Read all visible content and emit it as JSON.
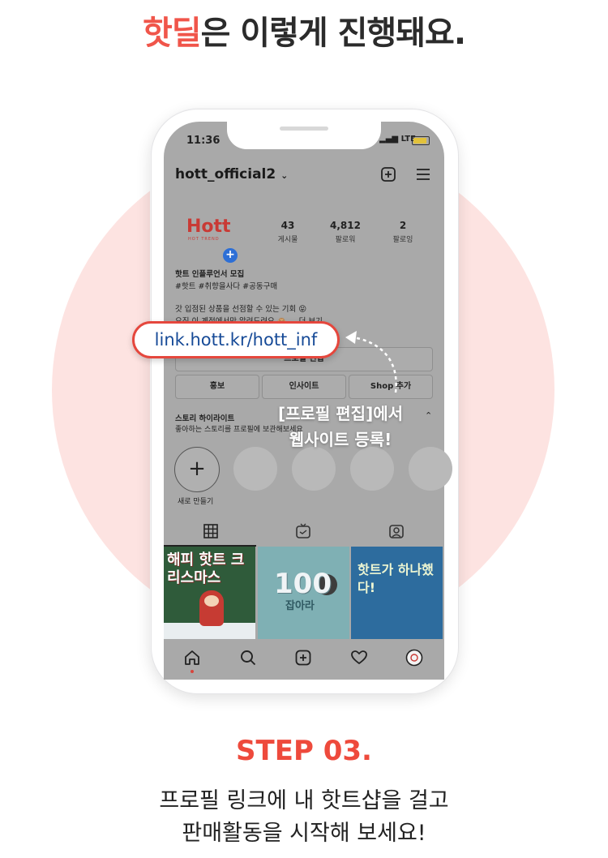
{
  "headline": {
    "highlight": "핫딜",
    "rest": "은 이렇게 진행돼요."
  },
  "status_bar": {
    "time": "11:36",
    "network": "LTE"
  },
  "profile": {
    "username": "hott_official2",
    "logo_text": "Hott",
    "logo_sub": "HOT TREND",
    "stats": [
      {
        "value": "43",
        "label": "게시물"
      },
      {
        "value": "4,812",
        "label": "팔로워"
      },
      {
        "value": "2",
        "label": "팔로잉"
      }
    ],
    "bio": [
      "핫트 인플루언서 모집",
      "#핫트 #취향을사다 #공동구매",
      "갓 입점된 상품을 선점할 수 있는 기회 😝",
      "오직 이 계정에서만 알려드려요 🙈 ... 더 보기"
    ],
    "link": "link.hott.kr/hott_inf",
    "edit_button": "프로필 편집",
    "action_buttons": [
      "홍보",
      "인사이트",
      "Shop 추가"
    ],
    "highlights_title": "스토리 하이라이트",
    "highlights_sub": "좋아하는 스토리를 프로필에 보관해보세요",
    "new_story": "새로 만들기"
  },
  "annotation": {
    "line1": "[프로필 편집]에서",
    "line2": "웹사이트 등록!"
  },
  "posts": [
    {
      "title": "해피 핫트 크리스마스"
    },
    {
      "title": "100",
      "sub": "잡아라"
    },
    {
      "title": "핫트가 하나했다!"
    }
  ],
  "step": {
    "label": "STEP 03.",
    "line1": "프로필 링크에 내 핫트샵을 걸고",
    "line2": "판매활동을 시작해 보세요!"
  },
  "colors": {
    "accent": "#ee4a3c",
    "link": "#164a97",
    "circle": "#fde3e1"
  }
}
